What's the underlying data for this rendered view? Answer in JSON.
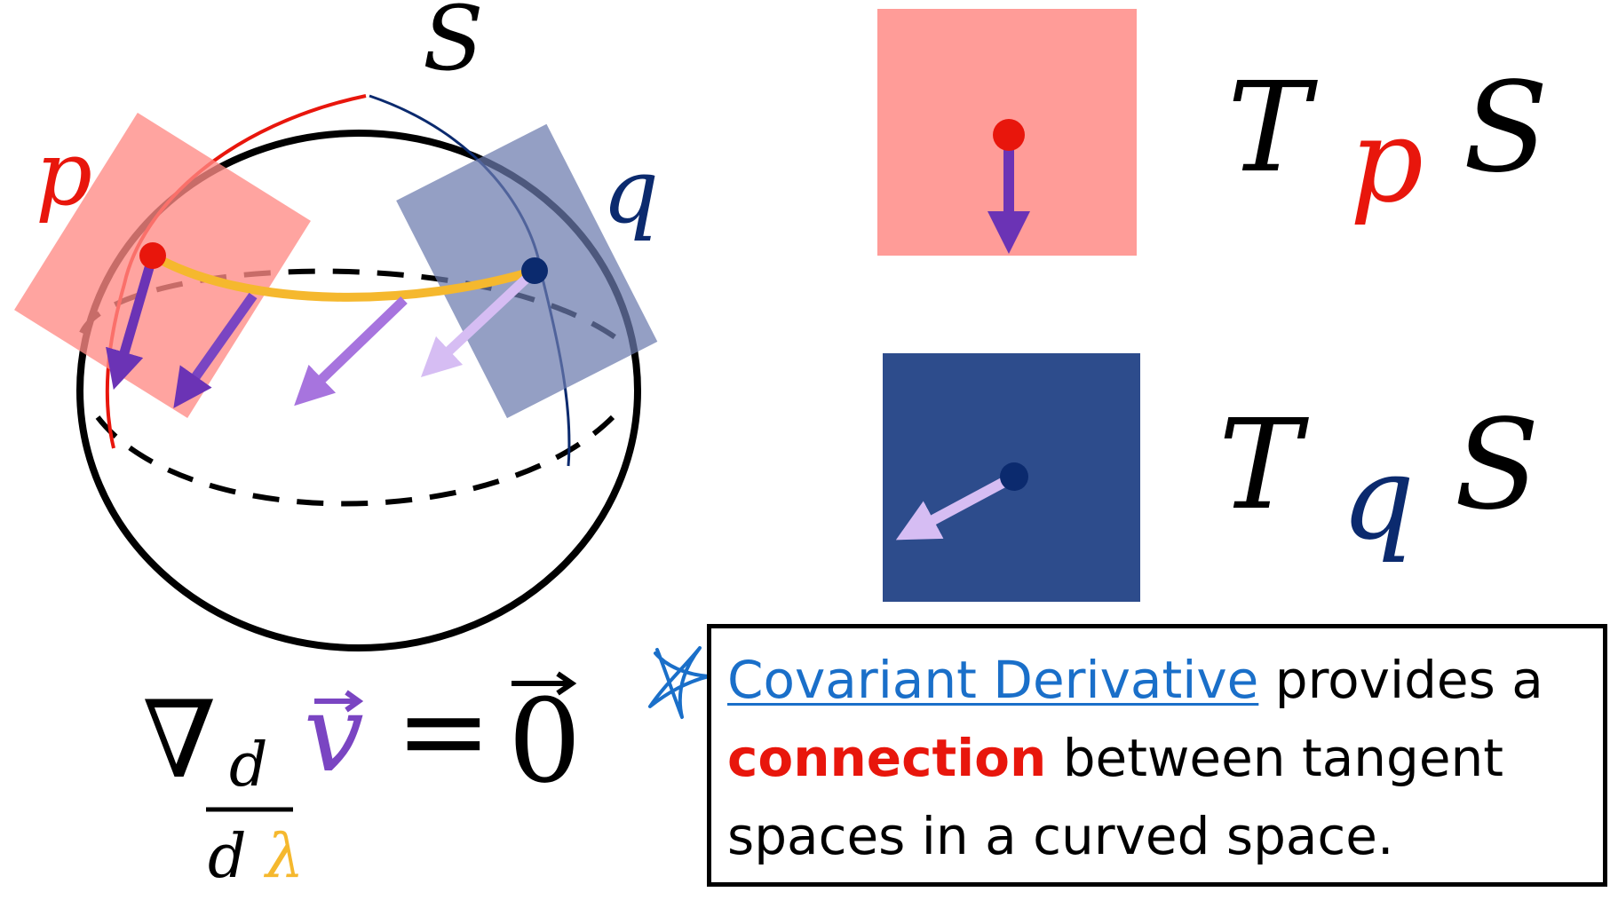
{
  "labels": {
    "surface": "S",
    "point_p": "p",
    "point_q": "q",
    "tangent_p": {
      "T": "T",
      "sub": "p",
      "S": "S"
    },
    "tangent_q": {
      "T": "T",
      "sub": "q",
      "S": "S"
    }
  },
  "equation": {
    "nabla": "∇",
    "num": "d",
    "den_d": "d",
    "den_lambda": "λ",
    "vector": "v",
    "equals": "=",
    "zero": "0"
  },
  "note": {
    "term": "Covariant Derivative",
    "part1": " provides a ",
    "emphasis": "connection",
    "part2": " between tangent spaces in a curved space."
  },
  "colors": {
    "red": "#e8160c",
    "navy": "#0b2a6e",
    "salmon": "#ff9c98",
    "slate": "#8b96bf",
    "blue_square": "#2d4c8c",
    "purple": "#7a45c2",
    "lavender": "#c39bea",
    "yellow": "#f5b82e",
    "link_blue": "#1a6fc9"
  },
  "icons": [
    "hand-drawn-star-icon"
  ]
}
